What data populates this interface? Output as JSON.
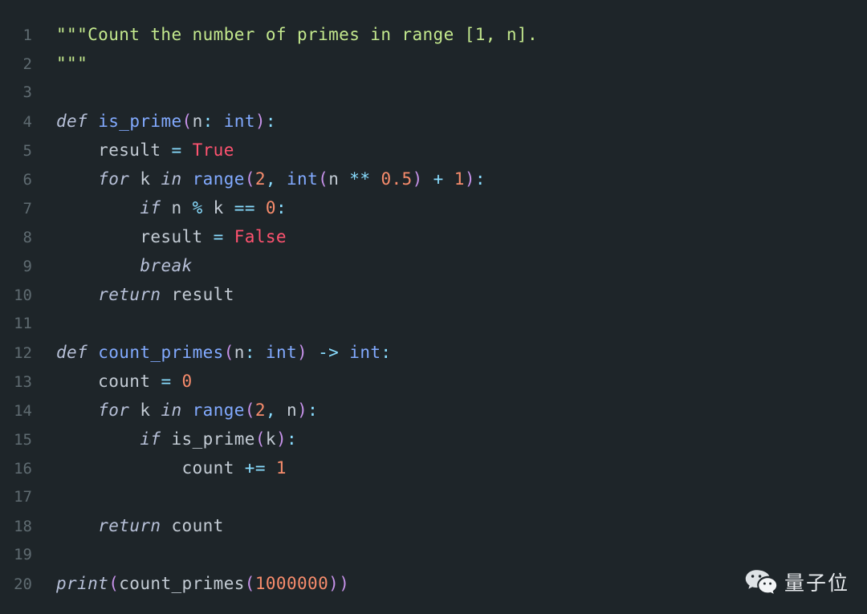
{
  "editor": {
    "background_color": "#1e2529",
    "gutter_color": "#5f6b71",
    "default_text_color": "#c3cbd4",
    "language": "python",
    "total_lines": 20,
    "line_numbers": [
      "1",
      "2",
      "3",
      "4",
      "5",
      "6",
      "7",
      "8",
      "9",
      "10",
      "11",
      "12",
      "13",
      "14",
      "15",
      "16",
      "17",
      "18",
      "19",
      "20"
    ],
    "lines": [
      {
        "number": "1",
        "text": "\"\"\"Count the number of primes in range [1, n].",
        "tokens": [
          {
            "t": "\"\"\"Count the number of primes in range [1, n].",
            "c": "t-string"
          }
        ]
      },
      {
        "number": "2",
        "text": "\"\"\"",
        "tokens": [
          {
            "t": "\"\"\"",
            "c": "t-string"
          }
        ]
      },
      {
        "number": "3",
        "text": "",
        "tokens": []
      },
      {
        "number": "4",
        "text": "def is_prime(n: int):",
        "tokens": [
          {
            "t": "def",
            "c": "t-keyword"
          },
          {
            "t": " ",
            "c": "t-plain"
          },
          {
            "t": "is_prime",
            "c": "t-func"
          },
          {
            "t": "(",
            "c": "t-punct"
          },
          {
            "t": "n",
            "c": "t-plain"
          },
          {
            "t": ":",
            "c": "t-op"
          },
          {
            "t": " ",
            "c": "t-plain"
          },
          {
            "t": "int",
            "c": "t-type"
          },
          {
            "t": ")",
            "c": "t-punct"
          },
          {
            "t": ":",
            "c": "t-op"
          }
        ]
      },
      {
        "number": "5",
        "text": "    result = True",
        "tokens": [
          {
            "t": "    result ",
            "c": "t-plain"
          },
          {
            "t": "=",
            "c": "t-op"
          },
          {
            "t": " ",
            "c": "t-plain"
          },
          {
            "t": "True",
            "c": "t-const"
          }
        ]
      },
      {
        "number": "6",
        "text": "    for k in range(2, int(n ** 0.5) + 1):",
        "tokens": [
          {
            "t": "    ",
            "c": "t-plain"
          },
          {
            "t": "for",
            "c": "t-keyword"
          },
          {
            "t": " k ",
            "c": "t-plain"
          },
          {
            "t": "in",
            "c": "t-keyword"
          },
          {
            "t": " ",
            "c": "t-plain"
          },
          {
            "t": "range",
            "c": "t-func"
          },
          {
            "t": "(",
            "c": "t-punct"
          },
          {
            "t": "2",
            "c": "t-number"
          },
          {
            "t": ",",
            "c": "t-op"
          },
          {
            "t": " ",
            "c": "t-plain"
          },
          {
            "t": "int",
            "c": "t-func"
          },
          {
            "t": "(",
            "c": "t-punct"
          },
          {
            "t": "n ",
            "c": "t-plain"
          },
          {
            "t": "**",
            "c": "t-op"
          },
          {
            "t": " ",
            "c": "t-plain"
          },
          {
            "t": "0.5",
            "c": "t-number"
          },
          {
            "t": ")",
            "c": "t-punct"
          },
          {
            "t": " ",
            "c": "t-plain"
          },
          {
            "t": "+",
            "c": "t-op"
          },
          {
            "t": " ",
            "c": "t-plain"
          },
          {
            "t": "1",
            "c": "t-number"
          },
          {
            "t": ")",
            "c": "t-punct"
          },
          {
            "t": ":",
            "c": "t-op"
          }
        ]
      },
      {
        "number": "7",
        "text": "        if n % k == 0:",
        "tokens": [
          {
            "t": "        ",
            "c": "t-plain"
          },
          {
            "t": "if",
            "c": "t-keyword"
          },
          {
            "t": " n ",
            "c": "t-plain"
          },
          {
            "t": "%",
            "c": "t-op"
          },
          {
            "t": " k ",
            "c": "t-plain"
          },
          {
            "t": "==",
            "c": "t-op"
          },
          {
            "t": " ",
            "c": "t-plain"
          },
          {
            "t": "0",
            "c": "t-number"
          },
          {
            "t": ":",
            "c": "t-op"
          }
        ]
      },
      {
        "number": "8",
        "text": "        result = False",
        "tokens": [
          {
            "t": "        result ",
            "c": "t-plain"
          },
          {
            "t": "=",
            "c": "t-op"
          },
          {
            "t": " ",
            "c": "t-plain"
          },
          {
            "t": "False",
            "c": "t-const"
          }
        ]
      },
      {
        "number": "9",
        "text": "        break",
        "tokens": [
          {
            "t": "        ",
            "c": "t-plain"
          },
          {
            "t": "break",
            "c": "t-keyword"
          }
        ]
      },
      {
        "number": "10",
        "text": "    return result",
        "tokens": [
          {
            "t": "    ",
            "c": "t-plain"
          },
          {
            "t": "return",
            "c": "t-keyword"
          },
          {
            "t": " result",
            "c": "t-plain"
          }
        ]
      },
      {
        "number": "11",
        "text": "",
        "tokens": []
      },
      {
        "number": "12",
        "text": "def count_primes(n: int) -> int:",
        "tokens": [
          {
            "t": "def",
            "c": "t-keyword"
          },
          {
            "t": " ",
            "c": "t-plain"
          },
          {
            "t": "count_primes",
            "c": "t-func"
          },
          {
            "t": "(",
            "c": "t-punct"
          },
          {
            "t": "n",
            "c": "t-plain"
          },
          {
            "t": ":",
            "c": "t-op"
          },
          {
            "t": " ",
            "c": "t-plain"
          },
          {
            "t": "int",
            "c": "t-type"
          },
          {
            "t": ")",
            "c": "t-punct"
          },
          {
            "t": " ",
            "c": "t-plain"
          },
          {
            "t": "->",
            "c": "t-op"
          },
          {
            "t": " ",
            "c": "t-plain"
          },
          {
            "t": "int",
            "c": "t-type"
          },
          {
            "t": ":",
            "c": "t-op"
          }
        ]
      },
      {
        "number": "13",
        "text": "    count = 0",
        "tokens": [
          {
            "t": "    count ",
            "c": "t-plain"
          },
          {
            "t": "=",
            "c": "t-op"
          },
          {
            "t": " ",
            "c": "t-plain"
          },
          {
            "t": "0",
            "c": "t-number"
          }
        ]
      },
      {
        "number": "14",
        "text": "    for k in range(2, n):",
        "tokens": [
          {
            "t": "    ",
            "c": "t-plain"
          },
          {
            "t": "for",
            "c": "t-keyword"
          },
          {
            "t": " k ",
            "c": "t-plain"
          },
          {
            "t": "in",
            "c": "t-keyword"
          },
          {
            "t": " ",
            "c": "t-plain"
          },
          {
            "t": "range",
            "c": "t-func"
          },
          {
            "t": "(",
            "c": "t-punct"
          },
          {
            "t": "2",
            "c": "t-number"
          },
          {
            "t": ",",
            "c": "t-op"
          },
          {
            "t": " n",
            "c": "t-plain"
          },
          {
            "t": ")",
            "c": "t-punct"
          },
          {
            "t": ":",
            "c": "t-op"
          }
        ]
      },
      {
        "number": "15",
        "text": "        if is_prime(k):",
        "tokens": [
          {
            "t": "        ",
            "c": "t-plain"
          },
          {
            "t": "if",
            "c": "t-keyword"
          },
          {
            "t": " is_prime",
            "c": "t-plain"
          },
          {
            "t": "(",
            "c": "t-punct"
          },
          {
            "t": "k",
            "c": "t-plain"
          },
          {
            "t": ")",
            "c": "t-punct"
          },
          {
            "t": ":",
            "c": "t-op"
          }
        ]
      },
      {
        "number": "16",
        "text": "            count += 1",
        "tokens": [
          {
            "t": "            count ",
            "c": "t-plain"
          },
          {
            "t": "+=",
            "c": "t-op"
          },
          {
            "t": " ",
            "c": "t-plain"
          },
          {
            "t": "1",
            "c": "t-number"
          }
        ]
      },
      {
        "number": "17",
        "text": "",
        "tokens": []
      },
      {
        "number": "18",
        "text": "    return count",
        "tokens": [
          {
            "t": "    ",
            "c": "t-plain"
          },
          {
            "t": "return",
            "c": "t-keyword"
          },
          {
            "t": " count",
            "c": "t-plain"
          }
        ]
      },
      {
        "number": "19",
        "text": "",
        "tokens": []
      },
      {
        "number": "20",
        "text": "print(count_primes(1000000))",
        "tokens": [
          {
            "t": "print",
            "c": "t-builtin"
          },
          {
            "t": "(",
            "c": "t-punct"
          },
          {
            "t": "count_primes",
            "c": "t-plain"
          },
          {
            "t": "(",
            "c": "t-punct"
          },
          {
            "t": "1000000",
            "c": "t-number"
          },
          {
            "t": ")",
            "c": "t-punct"
          },
          {
            "t": ")",
            "c": "t-punct"
          }
        ]
      }
    ]
  },
  "watermark": {
    "icon": "wechat-icon",
    "label": "量子位",
    "color": "#e6e9ec"
  }
}
